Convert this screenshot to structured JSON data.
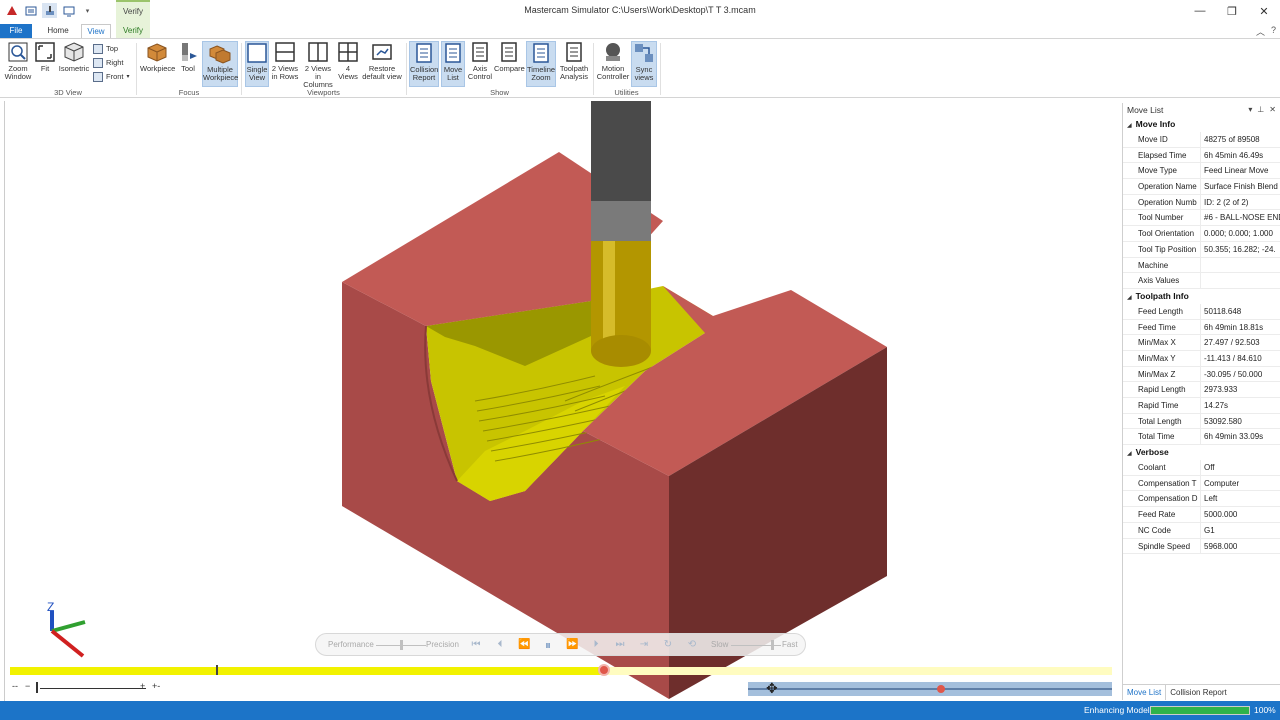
{
  "app": {
    "window_title": "Mastercam Simulator  C:\\Users\\Work\\Desktop\\T T 3.mcam"
  },
  "tabs": {
    "file": "File",
    "home": "Home",
    "view": "View",
    "verify": "Verify",
    "context": "Verify"
  },
  "ribbon": {
    "view3d": {
      "zoom_window": "Zoom\nWindow",
      "fit": "Fit",
      "isometric": "Isometric",
      "top": "Top",
      "right": "Right",
      "front": "Front",
      "group": "3D View"
    },
    "focus": {
      "workpiece": "Workpiece",
      "tool": "Tool",
      "multiple": "Multiple\nWorkpiece",
      "group": "Focus"
    },
    "viewports": {
      "single": "Single\nView",
      "rows": "2 Views\nin Rows",
      "cols": "2 Views in\nColumns",
      "four": "4\nViews",
      "restore": "Restore\ndefault view",
      "group": "Viewports"
    },
    "show": {
      "collision": "Collision\nReport",
      "movelist": "Move\nList",
      "axis": "Axis\nControl",
      "compare": "Compare",
      "timeline": "Timeline\nZoom",
      "analysis": "Toolpath\nAnalysis",
      "group": "Show"
    },
    "utilities": {
      "motion": "Motion\nController",
      "sync": "Sync\nviews",
      "group": "Utilities"
    }
  },
  "axes": {
    "z": "Z"
  },
  "playback": {
    "performance": "Performance",
    "precision": "Precision",
    "slow": "Slow",
    "fast": "Fast"
  },
  "timeline": {
    "progress": 0.539
  },
  "speed": {
    "position": 0.53
  },
  "panel": {
    "title": "Move List",
    "move_info": {
      "label": "Move Info",
      "rows": [
        {
          "name": "Move ID",
          "value": "48275 of 89508"
        },
        {
          "name": "Elapsed Time",
          "value": "6h 45min 46.49s"
        },
        {
          "name": "Move Type",
          "value": "Feed Linear Move"
        },
        {
          "name": "Operation Name",
          "value": "Surface Finish Blend"
        },
        {
          "name": "Operation Numb",
          "value": "ID: 2 (2 of 2)"
        },
        {
          "name": "Tool Number",
          "value": "#6 - BALL-NOSE END"
        },
        {
          "name": "Tool Orientation",
          "value": "0.000; 0.000; 1.000"
        },
        {
          "name": "Tool Tip Position",
          "value": "50.355; 16.282; -24."
        },
        {
          "name": "Machine",
          "value": ""
        },
        {
          "name": "Axis Values",
          "value": ""
        }
      ]
    },
    "toolpath_info": {
      "label": "Toolpath Info",
      "rows": [
        {
          "name": "Feed Length",
          "value": "50118.648"
        },
        {
          "name": "Feed Time",
          "value": "6h 49min 18.81s"
        },
        {
          "name": "Min/Max X",
          "value": "27.497 / 92.503"
        },
        {
          "name": "Min/Max Y",
          "value": "-11.413 / 84.610"
        },
        {
          "name": "Min/Max Z",
          "value": "-30.095 / 50.000"
        },
        {
          "name": "Rapid Length",
          "value": "2973.933"
        },
        {
          "name": "Rapid Time",
          "value": "14.27s"
        },
        {
          "name": "Total Length",
          "value": "53092.580"
        },
        {
          "name": "Total Time",
          "value": "6h 49min 33.09s"
        }
      ]
    },
    "verbose": {
      "label": "Verbose",
      "rows": [
        {
          "name": "Coolant",
          "value": "Off"
        },
        {
          "name": "Compensation T",
          "value": "Computer"
        },
        {
          "name": "Compensation D",
          "value": "Left"
        },
        {
          "name": "Feed Rate",
          "value": "5000.000"
        },
        {
          "name": "NC Code",
          "value": "G1"
        },
        {
          "name": "Spindle Speed",
          "value": "5968.000"
        }
      ]
    },
    "tabs": {
      "movelist": "Move List",
      "collision": "Collision Report"
    }
  },
  "status": {
    "text": "Enhancing Model",
    "percent_label": "100%",
    "progress": 1.0
  },
  "colors": {
    "workpiece_front": "#a84a48",
    "workpiece_top": "#c25a55",
    "workpiece_side": "#6e2e2c",
    "cut_surface": "#c8c400",
    "tool_holder": "#4a4a4a",
    "tool_body": "#b39600",
    "accent": "#1e73c8",
    "timeline": "#f2f200"
  }
}
